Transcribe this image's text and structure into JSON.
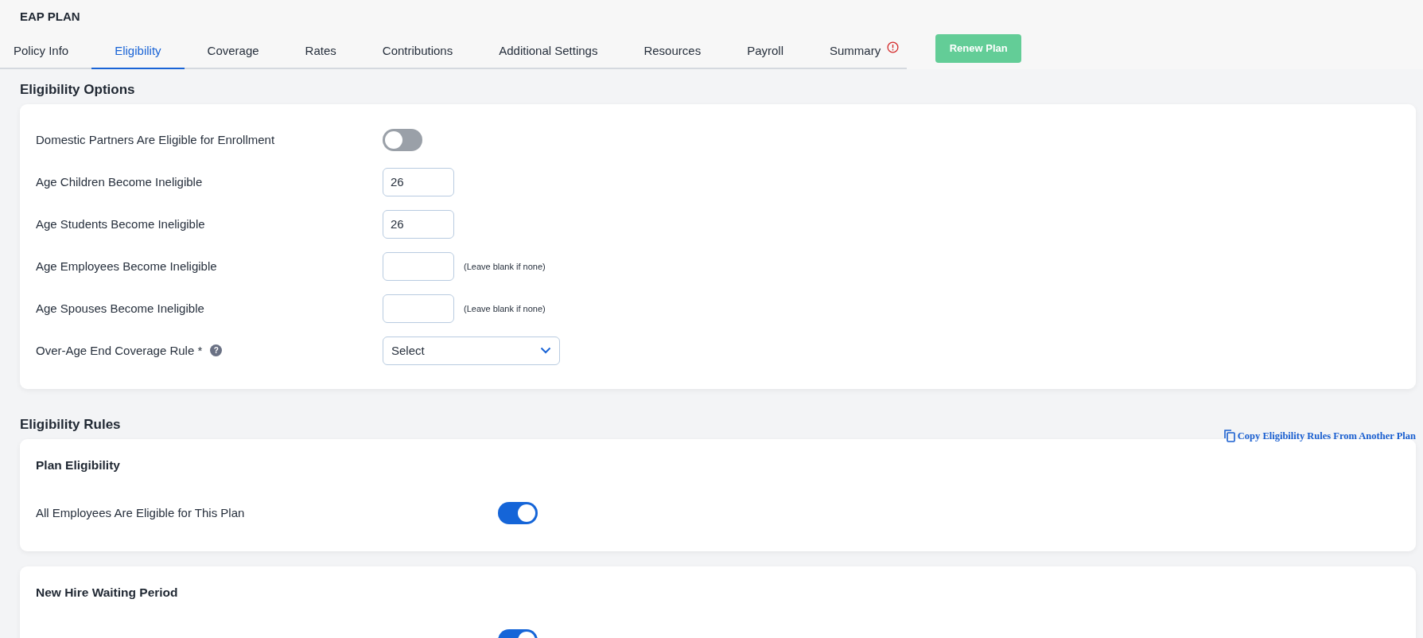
{
  "header": {
    "title": "EAP PLAN"
  },
  "tabs": [
    {
      "label": "Policy Info",
      "selected": false,
      "alert": false
    },
    {
      "label": "Eligibility",
      "selected": true,
      "alert": false
    },
    {
      "label": "Coverage",
      "selected": false,
      "alert": false
    },
    {
      "label": "Rates",
      "selected": false,
      "alert": false
    },
    {
      "label": "Contributions",
      "selected": false,
      "alert": false
    },
    {
      "label": "Additional Settings",
      "selected": false,
      "alert": false
    },
    {
      "label": "Resources",
      "selected": false,
      "alert": false
    },
    {
      "label": "Payroll",
      "selected": false,
      "alert": false
    },
    {
      "label": "Summary",
      "selected": false,
      "alert": true
    }
  ],
  "renew_button": "Renew Plan",
  "sections": [
    {
      "heading": "Eligibility Options",
      "cards": [
        {
          "rows": [
            {
              "kind": "toggle",
              "label": "Domestic Partners Are Eligible for Enrollment",
              "on": false
            },
            {
              "kind": "number",
              "label": "Age Children Become Ineligible",
              "value": "26"
            },
            {
              "kind": "number",
              "label": "Age Students Become Ineligible",
              "value": "26"
            },
            {
              "kind": "number",
              "label": "Age Employees Become Ineligible",
              "hint": "(Leave blank if none)"
            },
            {
              "kind": "number",
              "label": "Age Spouses Become Ineligible",
              "hint": "(Leave blank if none)"
            },
            {
              "kind": "select",
              "label": "Over-Age End Coverage Rule *",
              "help": "?",
              "value": "Select"
            }
          ]
        }
      ]
    },
    {
      "heading": "Eligibility Rules",
      "link": "Copy Eligibility Rules From Another Plan",
      "cards": [
        {
          "title": "Plan Eligibility",
          "rows": [
            {
              "kind": "toggle",
              "label": "All Employees Are Eligible for This Plan",
              "on": true
            }
          ]
        },
        {
          "title": "New Hire Waiting Period",
          "rows": [
            {
              "kind": "toggle",
              "on": true
            }
          ]
        }
      ]
    }
  ]
}
